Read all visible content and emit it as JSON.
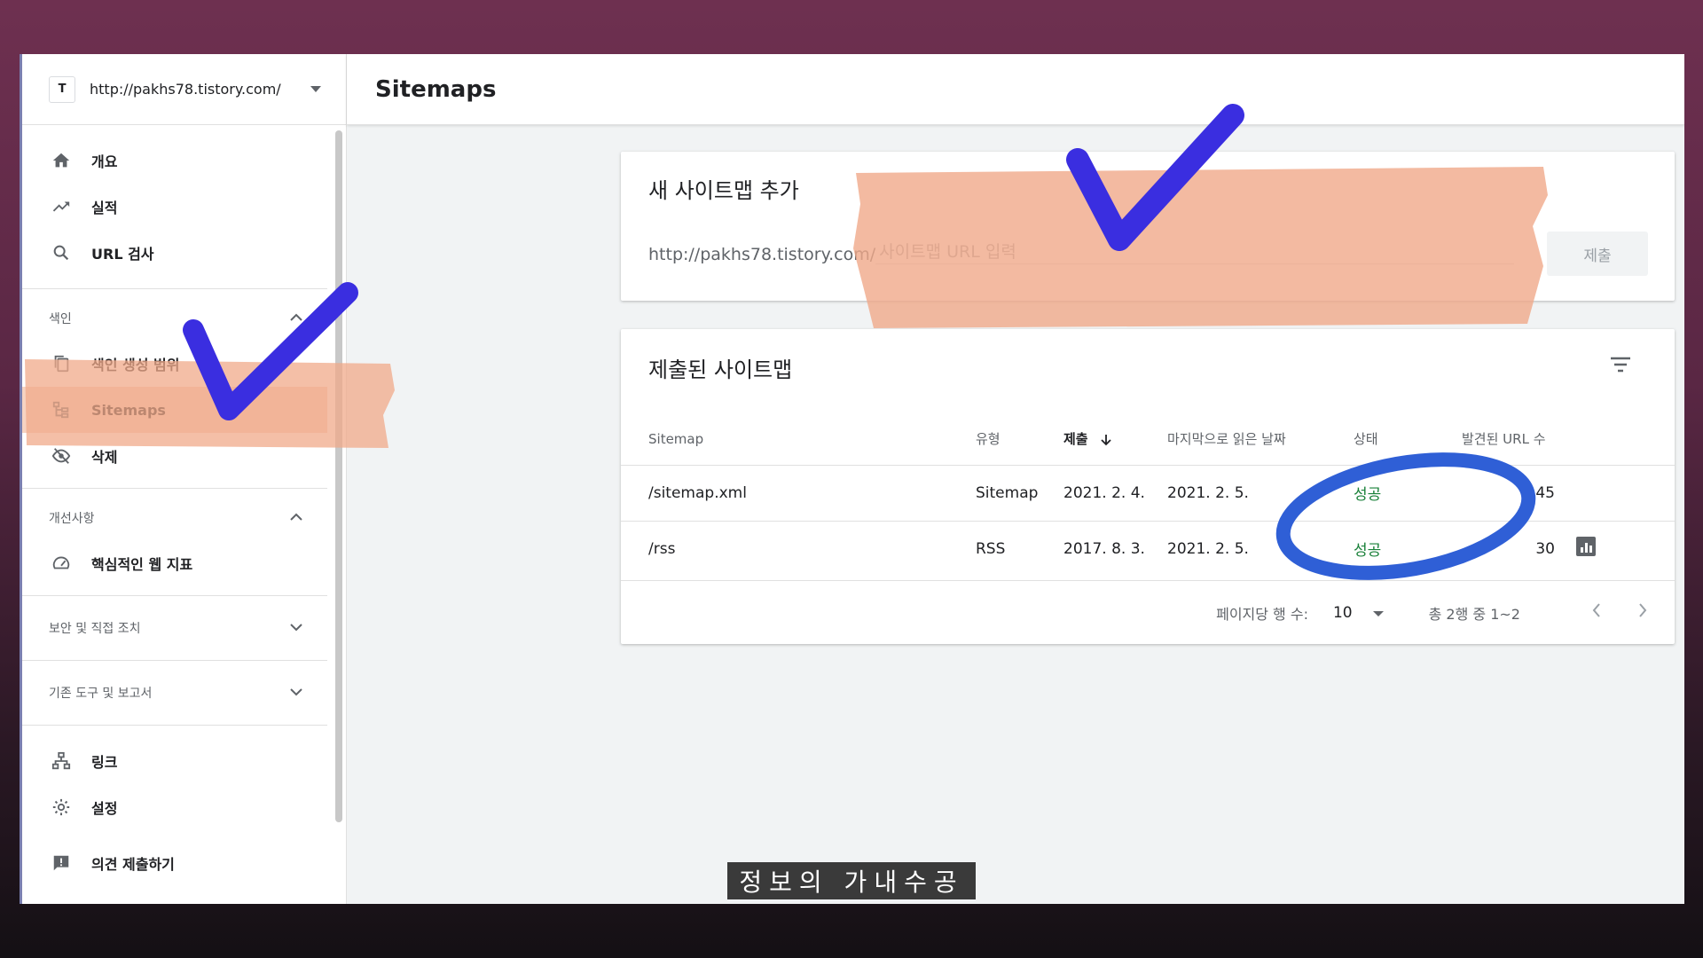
{
  "property": {
    "logo": "T",
    "url": "http://pakhs78.tistory.com/"
  },
  "nav_top": [
    {
      "label": "개요",
      "icon": "home-icon"
    },
    {
      "label": "실적",
      "icon": "trending-up-icon"
    },
    {
      "label": "URL 검사",
      "icon": "search-icon"
    }
  ],
  "section_index": {
    "title": "색인",
    "items": [
      {
        "label": "색인 생성 범위",
        "icon": "copy-icon"
      },
      {
        "label": "Sitemaps",
        "icon": "sitemap-icon"
      },
      {
        "label": "삭제",
        "icon": "eye-off-icon"
      }
    ]
  },
  "section_improve": {
    "title": "개선사항",
    "items": [
      {
        "label": "핵심적인 웹 지표",
        "icon": "gauge-icon"
      }
    ]
  },
  "section_security": {
    "title": "보안 및 직접 조치"
  },
  "section_legacy": {
    "title": "기존 도구 및 보고서"
  },
  "nav_bottom": [
    {
      "label": "링크",
      "icon": "links-icon"
    },
    {
      "label": "설정",
      "icon": "gear-icon"
    }
  ],
  "feedback": {
    "label": "의견 제출하기",
    "icon": "feedback-icon"
  },
  "header": {
    "title": "Sitemaps"
  },
  "add_sitemap": {
    "title": "새 사이트맵 추가",
    "prefix": "http://pakhs78.tistory.com/",
    "placeholder": "사이트맵 URL 입력",
    "submit_label": "제출"
  },
  "submitted": {
    "title": "제출된 사이트맵",
    "columns": [
      "Sitemap",
      "유형",
      "제출",
      "마지막으로 읽은 날짜",
      "상태",
      "발견된 URL 수"
    ],
    "rows": [
      {
        "sitemap": "/sitemap.xml",
        "type": "Sitemap",
        "submitted": "2021. 2. 4.",
        "last_read": "2021. 2. 5.",
        "status": "성공",
        "urls": "45"
      },
      {
        "sitemap": "/rss",
        "type": "RSS",
        "submitted": "2017. 8. 3.",
        "last_read": "2021. 2. 5.",
        "status": "성공",
        "urls": "30"
      }
    ],
    "pager": {
      "rows_label": "페이지당 행 수:",
      "rows_value": "10",
      "range": "총 2행 중 1~2"
    }
  },
  "caption": "정보의 가내수공",
  "colors": {
    "success": "#188038",
    "highlight": "#f6c5ad",
    "marker": "#3a2ee0"
  }
}
